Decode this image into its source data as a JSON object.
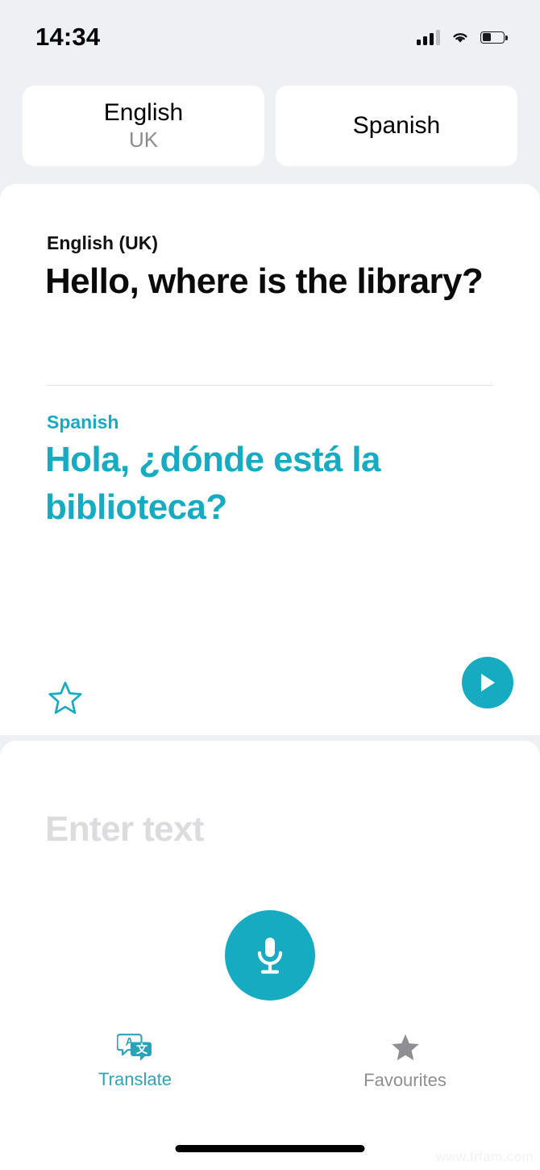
{
  "status_bar": {
    "time": "14:34",
    "cellular_icon": "signal-bars-icon",
    "wifi_icon": "wifi-icon",
    "battery_icon": "battery-icon",
    "battery_level_pct": 42
  },
  "language_selector": {
    "source": {
      "name": "English",
      "region": "UK"
    },
    "target": {
      "name": "Spanish",
      "region": ""
    }
  },
  "translation_card": {
    "source_label": "English (UK)",
    "source_text": "Hello, where is the library?",
    "target_label": "Spanish",
    "target_text": "Hola, ¿dónde está la biblioteca?",
    "favourite_icon": "star-outline-icon",
    "play_icon": "play-icon"
  },
  "input_card": {
    "placeholder": "Enter text",
    "value": "",
    "mic_icon": "microphone-icon"
  },
  "tab_bar": {
    "tabs": [
      {
        "label": "Translate",
        "icon": "translate-bubbles-icon",
        "active": true
      },
      {
        "label": "Favourites",
        "icon": "star-filled-icon",
        "active": false
      }
    ]
  },
  "colors": {
    "accent_teal": "#17abc2",
    "tab_active": "#2fa3b5",
    "tab_inactive": "#8e8e93",
    "page_background": "#eff0f4",
    "card_background": "#ffffff",
    "placeholder_grey": "#dcdcde",
    "sub_label_grey": "#8b8b90"
  },
  "watermark": "www.frfam.com"
}
